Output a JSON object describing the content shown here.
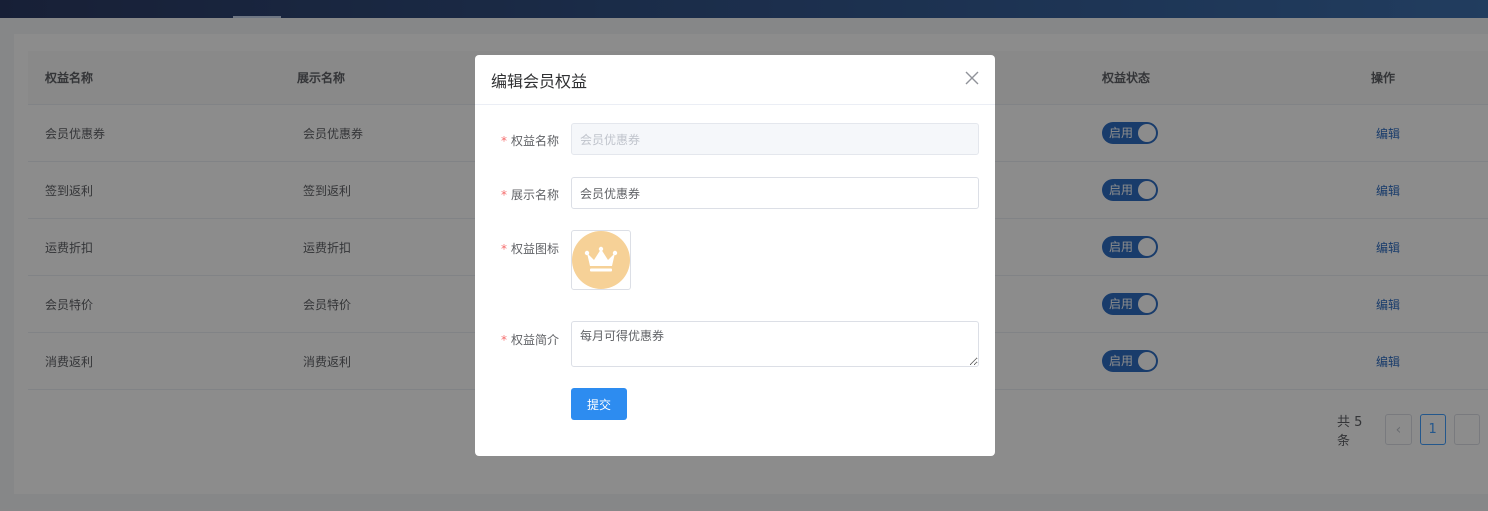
{
  "table": {
    "columns": {
      "name": "权益名称",
      "display": "展示名称",
      "status": "权益状态",
      "operation": "操作"
    },
    "rows": [
      {
        "name": "会员优惠券",
        "display": "会员优惠券",
        "status": "启用",
        "op": "编辑"
      },
      {
        "name": "签到返利",
        "display": "签到返利",
        "status": "启用",
        "op": "编辑"
      },
      {
        "name": "运费折扣",
        "display": "运费折扣",
        "status": "启用",
        "op": "编辑"
      },
      {
        "name": "会员特价",
        "display": "会员特价",
        "status": "启用",
        "op": "编辑"
      },
      {
        "name": "消费返利",
        "display": "消费返利",
        "status": "启用",
        "op": "编辑"
      }
    ]
  },
  "pagination": {
    "total": "共 5 条",
    "prev_icon": "‹",
    "current": "1"
  },
  "dialog": {
    "title": "编辑会员权益",
    "fields": {
      "name_label": "权益名称",
      "name_value": "会员优惠券",
      "display_label": "展示名称",
      "display_value": "会员优惠券",
      "icon_label": "权益图标",
      "icon": "crown-icon",
      "intro_label": "权益简介",
      "intro_value": "每月可得优惠券"
    },
    "required_mark": "*",
    "submit_label": "提交"
  },
  "colors": {
    "primary": "#2d8cf0",
    "switch_on": "#2f6ec4",
    "required": "#f56c6c",
    "crown_bg": "#f6d197"
  }
}
